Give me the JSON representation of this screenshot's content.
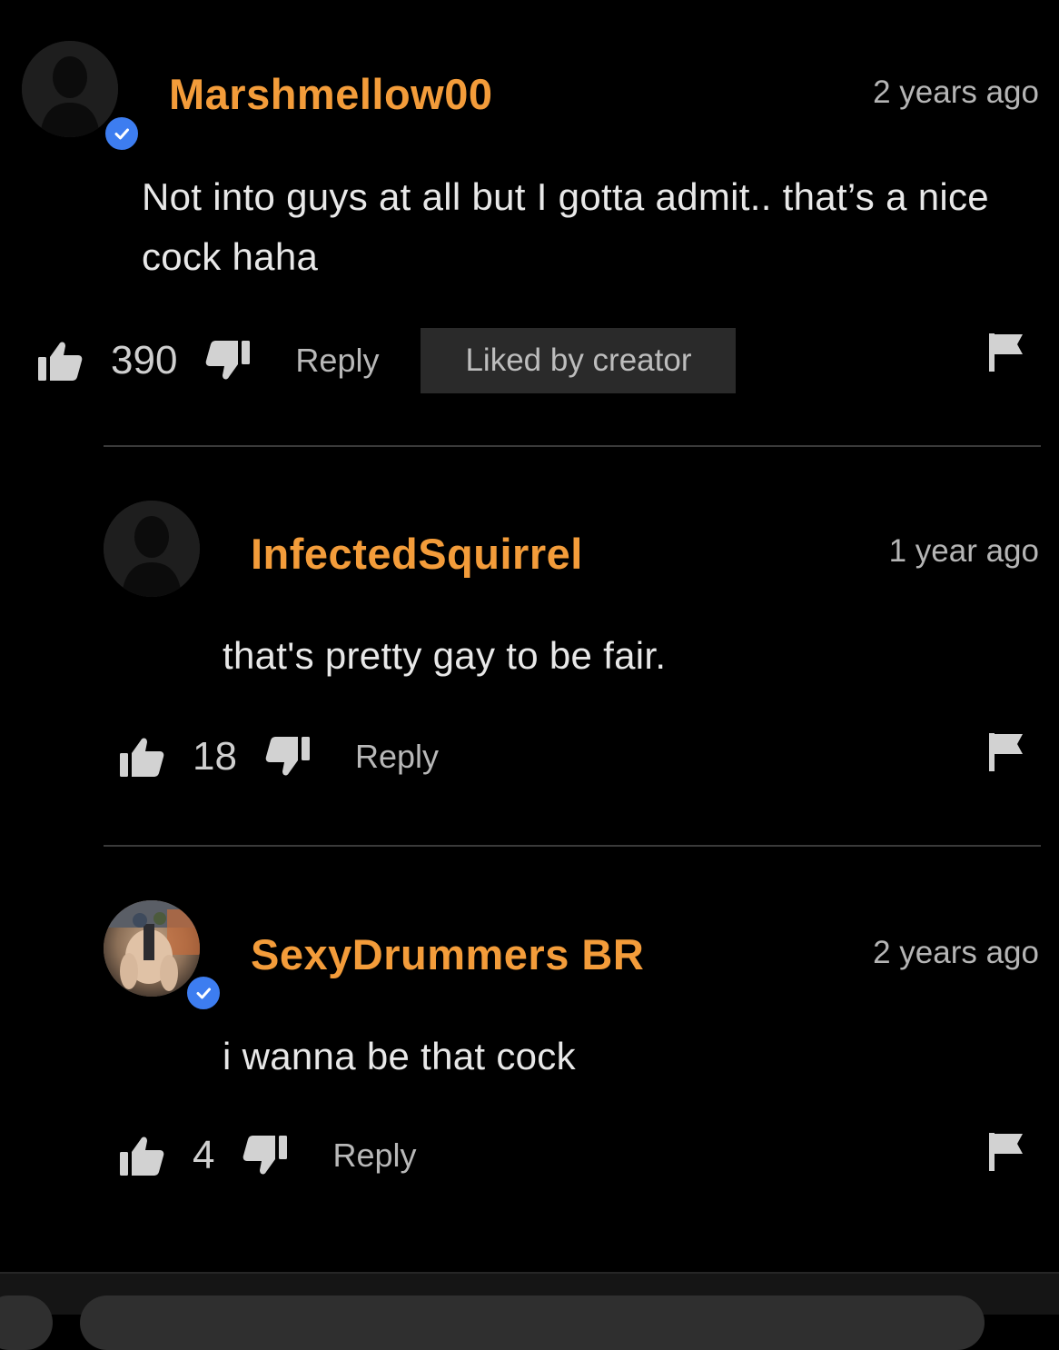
{
  "comments": [
    {
      "username": "Marshmellow00",
      "time": "2 years ago",
      "text": "Not into guys at all but I gotta admit.. that’s a nice cock haha",
      "likes": "390",
      "reply_label": "Reply",
      "badge": "Liked by creator",
      "verified": true,
      "avatar": "default-avatar"
    },
    {
      "username": "InfectedSquirrel",
      "time": "1 year ago",
      "text": "that's pretty gay to be fair.",
      "likes": "18",
      "reply_label": "Reply",
      "verified": false,
      "avatar": "default-avatar"
    },
    {
      "username": "SexyDrummers BR",
      "time": "2 years ago",
      "text": "i wanna be that cock",
      "likes": "4",
      "reply_label": "Reply",
      "verified": true,
      "avatar": "photo-avatar"
    }
  ],
  "icons": {
    "like": "thumbs-up-icon",
    "dislike": "thumbs-down-icon",
    "flag": "flag-icon",
    "verified": "verified-check-icon"
  },
  "colors": {
    "background": "#000000",
    "username": "#f39c3a",
    "verified": "#3d7df0",
    "badge_bg": "#2a2a2a"
  }
}
